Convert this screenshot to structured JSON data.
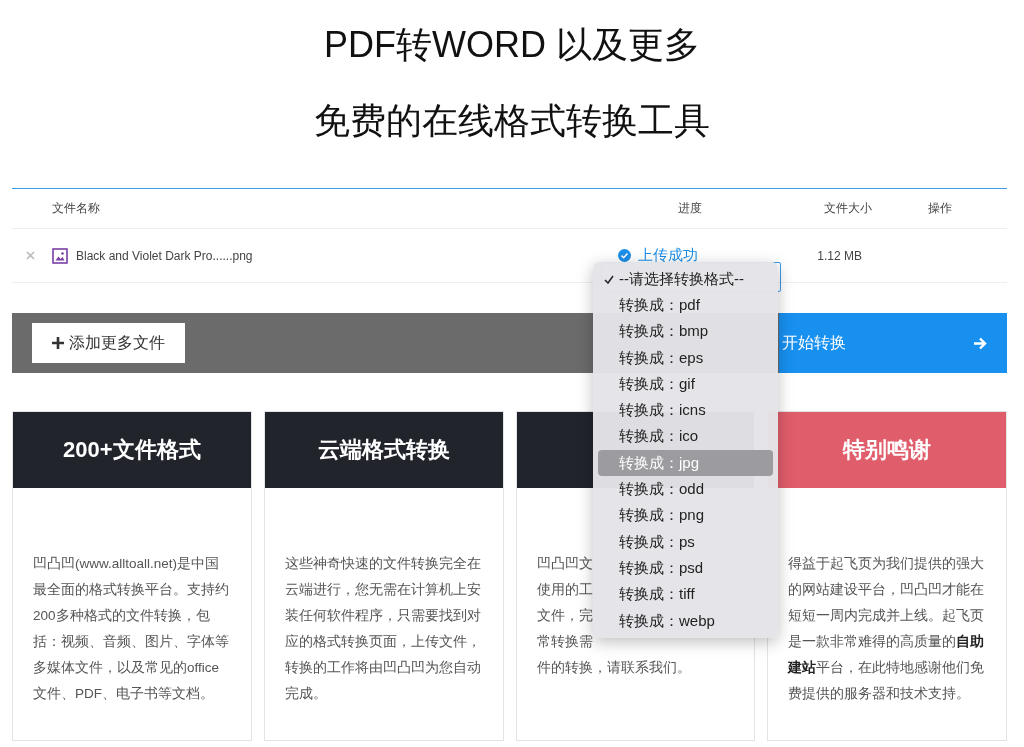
{
  "heading": {
    "lines": [
      "PDF转WORD 以及更多",
      "免费的在线格式转换工具"
    ]
  },
  "file_table": {
    "columns": [
      "文件名称",
      "进度",
      "文件大小",
      "操作"
    ],
    "rows": [
      {
        "name": "Black and Violet Dark Pro......png",
        "status": "上传成功",
        "size": "1.12 MB"
      }
    ]
  },
  "format_menu": {
    "items": [
      {
        "label": "--请选择转换格式--",
        "checked": true,
        "selected": false
      },
      {
        "label": "转换成：pdf",
        "checked": false,
        "selected": false
      },
      {
        "label": "转换成：bmp",
        "checked": false,
        "selected": false
      },
      {
        "label": "转换成：eps",
        "checked": false,
        "selected": false
      },
      {
        "label": "转换成：gif",
        "checked": false,
        "selected": false
      },
      {
        "label": "转换成：icns",
        "checked": false,
        "selected": false
      },
      {
        "label": "转换成：ico",
        "checked": false,
        "selected": false
      },
      {
        "label": "转换成：jpg",
        "checked": false,
        "selected": true
      },
      {
        "label": "转换成：odd",
        "checked": false,
        "selected": false
      },
      {
        "label": "转换成：png",
        "checked": false,
        "selected": false
      },
      {
        "label": "转换成：ps",
        "checked": false,
        "selected": false
      },
      {
        "label": "转换成：psd",
        "checked": false,
        "selected": false
      },
      {
        "label": "转换成：tiff",
        "checked": false,
        "selected": false
      },
      {
        "label": "转换成：webp",
        "checked": false,
        "selected": false
      }
    ]
  },
  "action_bar": {
    "add_button": "添加更多文件",
    "start_button": "开始转换"
  },
  "cards": [
    {
      "kind": "dark",
      "title": "200+文件格式",
      "lines": [
        "凹凸凹(www.alltoall.net)是中国",
        "最全面的格式转换平台。支持约",
        "200多种格式的文件转换，包",
        "括：视频、音频、图片、字体等",
        "多媒体文件，以及常见的office",
        "文件、PDF、电子书等文档。"
      ]
    },
    {
      "kind": "dark",
      "title": "云端格式转换",
      "lines": [
        "这些神奇快速的文件转换完全在",
        "云端进行，您无需在计算机上安",
        "装任何软件程序，只需要找到对",
        "应的格式转换页面，上传文件，",
        "转换的工作将由凹凸凹为您自动",
        "完成。"
      ]
    },
    {
      "kind": "dark",
      "lines": [
        "凹凸凹文",
        "使用的工",
        "文件，完",
        "常转换需",
        "件的转换，请联系我们。"
      ]
    },
    {
      "kind": "accent",
      "title": "特别鸣谢",
      "lines": [
        "得益于起飞页为我们提供的强大",
        "的网站建设平台，凹凸凹才能在",
        "短短一周内完成并上线。起飞页",
        "是一款非常难得的高质量的**自助**",
        "**建站**平台，在此特地感谢他们免",
        "费提供的服务器和技术支持。"
      ]
    }
  ]
}
